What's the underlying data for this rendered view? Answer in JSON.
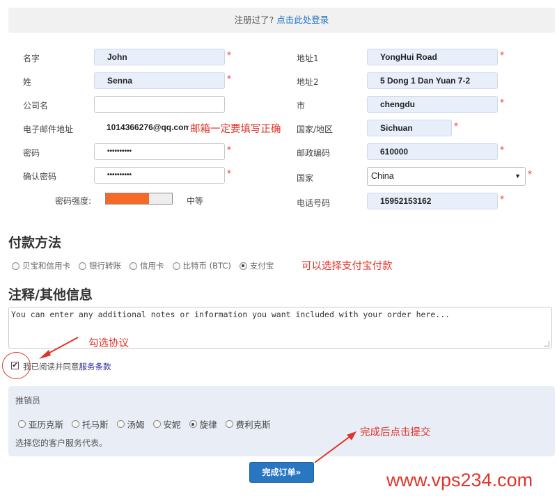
{
  "login_bar": {
    "prompt": "注册过了?",
    "link": "点击此处登录"
  },
  "form": {
    "left": [
      {
        "label": "名字",
        "value": "John",
        "required": "*"
      },
      {
        "label": "姓",
        "value": "Senna",
        "required": "*"
      },
      {
        "label": "公司名",
        "value": "",
        "required": ""
      },
      {
        "label": "电子邮件地址",
        "value": "1014366276@qq.com",
        "required": ""
      },
      {
        "label": "密码",
        "value": "••••••••••",
        "required": "*"
      },
      {
        "label": "确认密码",
        "value": "••••••••••",
        "required": "*"
      }
    ],
    "right": [
      {
        "label": "地址1",
        "value": "YongHui Road",
        "required": "*"
      },
      {
        "label": "地址2",
        "value": "5 Dong 1 Dan Yuan 7-2",
        "required": ""
      },
      {
        "label": "市",
        "value": "chengdu",
        "required": "*"
      },
      {
        "label": "国家/地区",
        "value": "Sichuan",
        "required": "*"
      },
      {
        "label": "邮政编码",
        "value": "610000",
        "required": "*"
      },
      {
        "label": "国家",
        "value": "China",
        "required": "*"
      },
      {
        "label": "电话号码",
        "value": "15952153162",
        "required": "*"
      }
    ],
    "password_strength": {
      "label": "密码强度:",
      "level": "中等",
      "fill_fraction": 0.65,
      "color": "#f56a26"
    }
  },
  "annotations": {
    "email": "邮箱一定要填写正确",
    "payment": "可以选择支付宝付款",
    "agree": "勾选协议",
    "submit": "完成后点击提交",
    "color": "#e0342a"
  },
  "payment": {
    "title": "付款方法",
    "options": [
      "贝宝和信用卡",
      "银行转账",
      "信用卡",
      "比特币 (BTC)",
      "支付宝"
    ],
    "selected": "支付宝"
  },
  "notes": {
    "title": "注释/其他信息",
    "text": "You can enter any additional notes or information you want included with your order here..."
  },
  "agreement": {
    "text": "我已阅读并同意",
    "link": "服务条款",
    "checked": true
  },
  "sales_rep": {
    "title": "推销员",
    "options": [
      "亚历克斯",
      "托马斯",
      "汤姆",
      "安妮",
      "旋律",
      "费利克斯"
    ],
    "selected": "旋律",
    "help": "选择您的客户服务代表。"
  },
  "submit_label": "完成订单»",
  "watermark": "www.vps234.com"
}
